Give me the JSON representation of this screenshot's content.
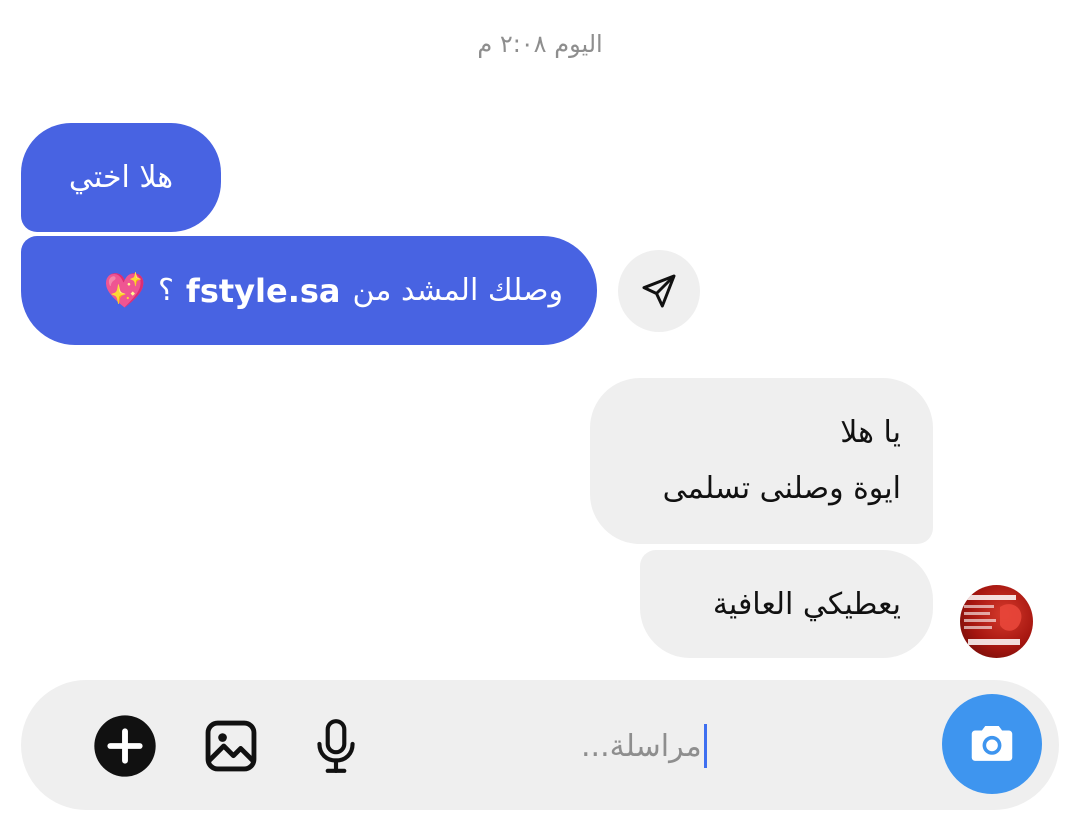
{
  "timestamp": "اليوم ٢:٠٨ م",
  "messages": [
    {
      "side": "sent",
      "text": "هلا اختي"
    },
    {
      "side": "sent",
      "text": "وصلك المشد من",
      "brand": "fstyle.sa",
      "suffix": "؟",
      "emoji": "💖"
    },
    {
      "side": "received",
      "lines": [
        "يا هلا",
        "ايوة وصلنى تسلمى"
      ]
    },
    {
      "side": "received",
      "text": "يعطيكي العافية"
    }
  ],
  "composer": {
    "placeholder": "مراسلة..."
  },
  "icons": {
    "share": "paper-plane-icon",
    "camera": "camera-icon",
    "gallery": "gallery-icon",
    "mic": "microphone-icon",
    "add": "plus-icon"
  },
  "colors": {
    "sent_bubble": "#4863e2",
    "received_bubble": "#efefef",
    "camera_button": "#3e95ef"
  }
}
